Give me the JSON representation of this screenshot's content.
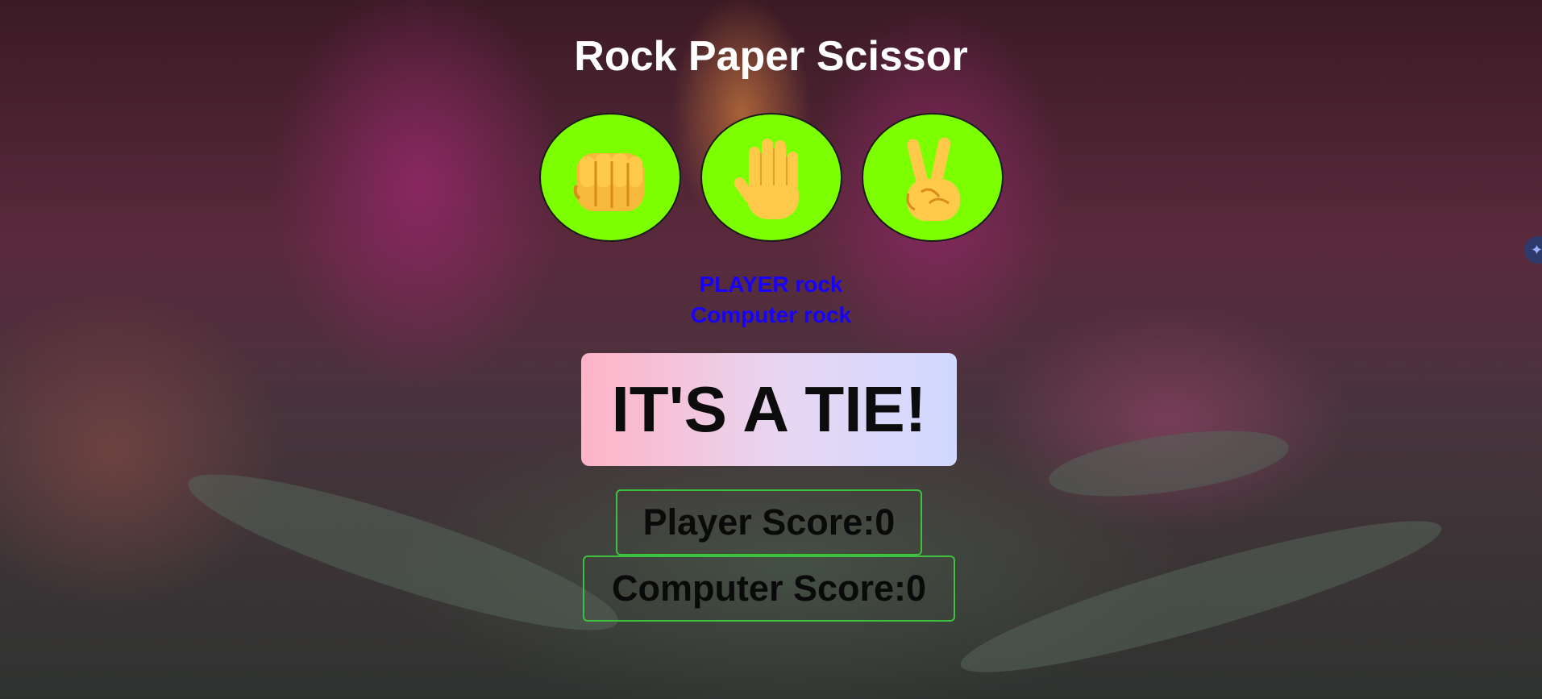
{
  "title": "Rock Paper Scissor",
  "choices": [
    {
      "name": "rock",
      "icon": "fist-icon"
    },
    {
      "name": "paper",
      "icon": "raised-hand-icon"
    },
    {
      "name": "scissor",
      "icon": "victory-hand-icon"
    }
  ],
  "messages": {
    "player": "PLAYER rock",
    "computer": "Computer rock"
  },
  "result": "IT'S A TIE!",
  "scores": {
    "player_label": "Player Score:0",
    "computer_label": "Computer Score:0"
  },
  "colors": {
    "choice_bg": "#7cff00",
    "message_text": "#1800ff",
    "score_border": "#3ec13e"
  }
}
